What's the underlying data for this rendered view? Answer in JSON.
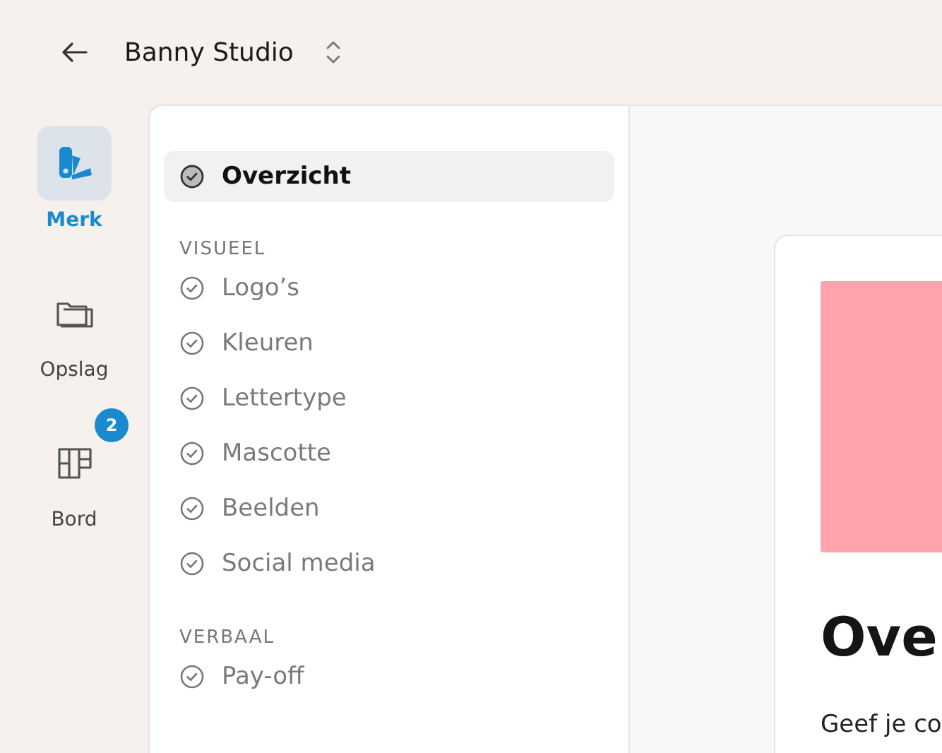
{
  "header": {
    "title": "Banny Studio"
  },
  "rail": [
    {
      "kind": "swatches",
      "label": "Merk",
      "selected": true
    },
    {
      "kind": "folder",
      "label": "Opslag",
      "selected": false
    },
    {
      "kind": "board",
      "label": "Bord",
      "selected": false,
      "badge": "2"
    }
  ],
  "nav": {
    "overview": {
      "label": "Overzicht",
      "selected": true
    },
    "sections": [
      {
        "title": "VISUEEL",
        "items": [
          {
            "label": "Logo’s",
            "selected": false
          },
          {
            "label": "Kleuren",
            "selected": false
          },
          {
            "label": "Lettertype",
            "selected": false
          },
          {
            "label": "Mascotte",
            "selected": false
          },
          {
            "label": "Beelden",
            "selected": false
          },
          {
            "label": "Social media",
            "selected": false
          }
        ]
      },
      {
        "title": "VERBAAL",
        "items": [
          {
            "label": "Pay-off",
            "selected": false
          }
        ]
      }
    ]
  },
  "content": {
    "heading": "Ove",
    "text": "Geef je co"
  }
}
